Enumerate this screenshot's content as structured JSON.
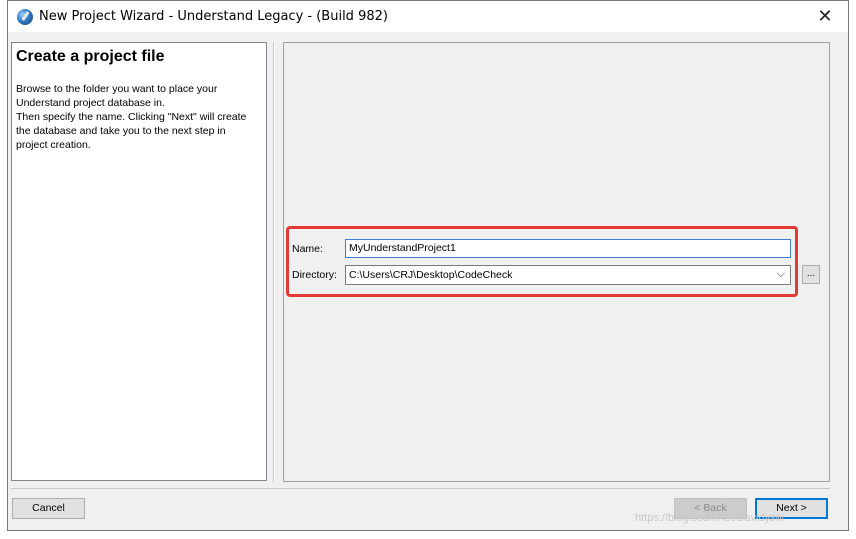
{
  "window": {
    "title": "New Project Wizard - Understand Legacy - (Build 982)",
    "close_glyph": "✕",
    "app_icon": "understand-logo-icon"
  },
  "left_panel": {
    "heading": "Create a project file",
    "description": "Browse to the folder you want to place your\nUnderstand project database in.\nThen specify the name. Clicking \"Next\" will create\nthe database and take you to the next step in\nproject creation."
  },
  "form": {
    "name_label": "Name:",
    "name_value": "MyUnderstandProject1",
    "directory_label": "Directory:",
    "directory_value": "C:\\Users\\CRJ\\Desktop\\CodeCheck",
    "directory_chevron": "⌵",
    "browse_label": "...",
    "highlight_color": "#e53935"
  },
  "footer": {
    "cancel_label": "Cancel",
    "back_label": "< Back",
    "next_label": "Next >"
  },
  "watermark": "https://blog.csdn.net/Davidysw"
}
